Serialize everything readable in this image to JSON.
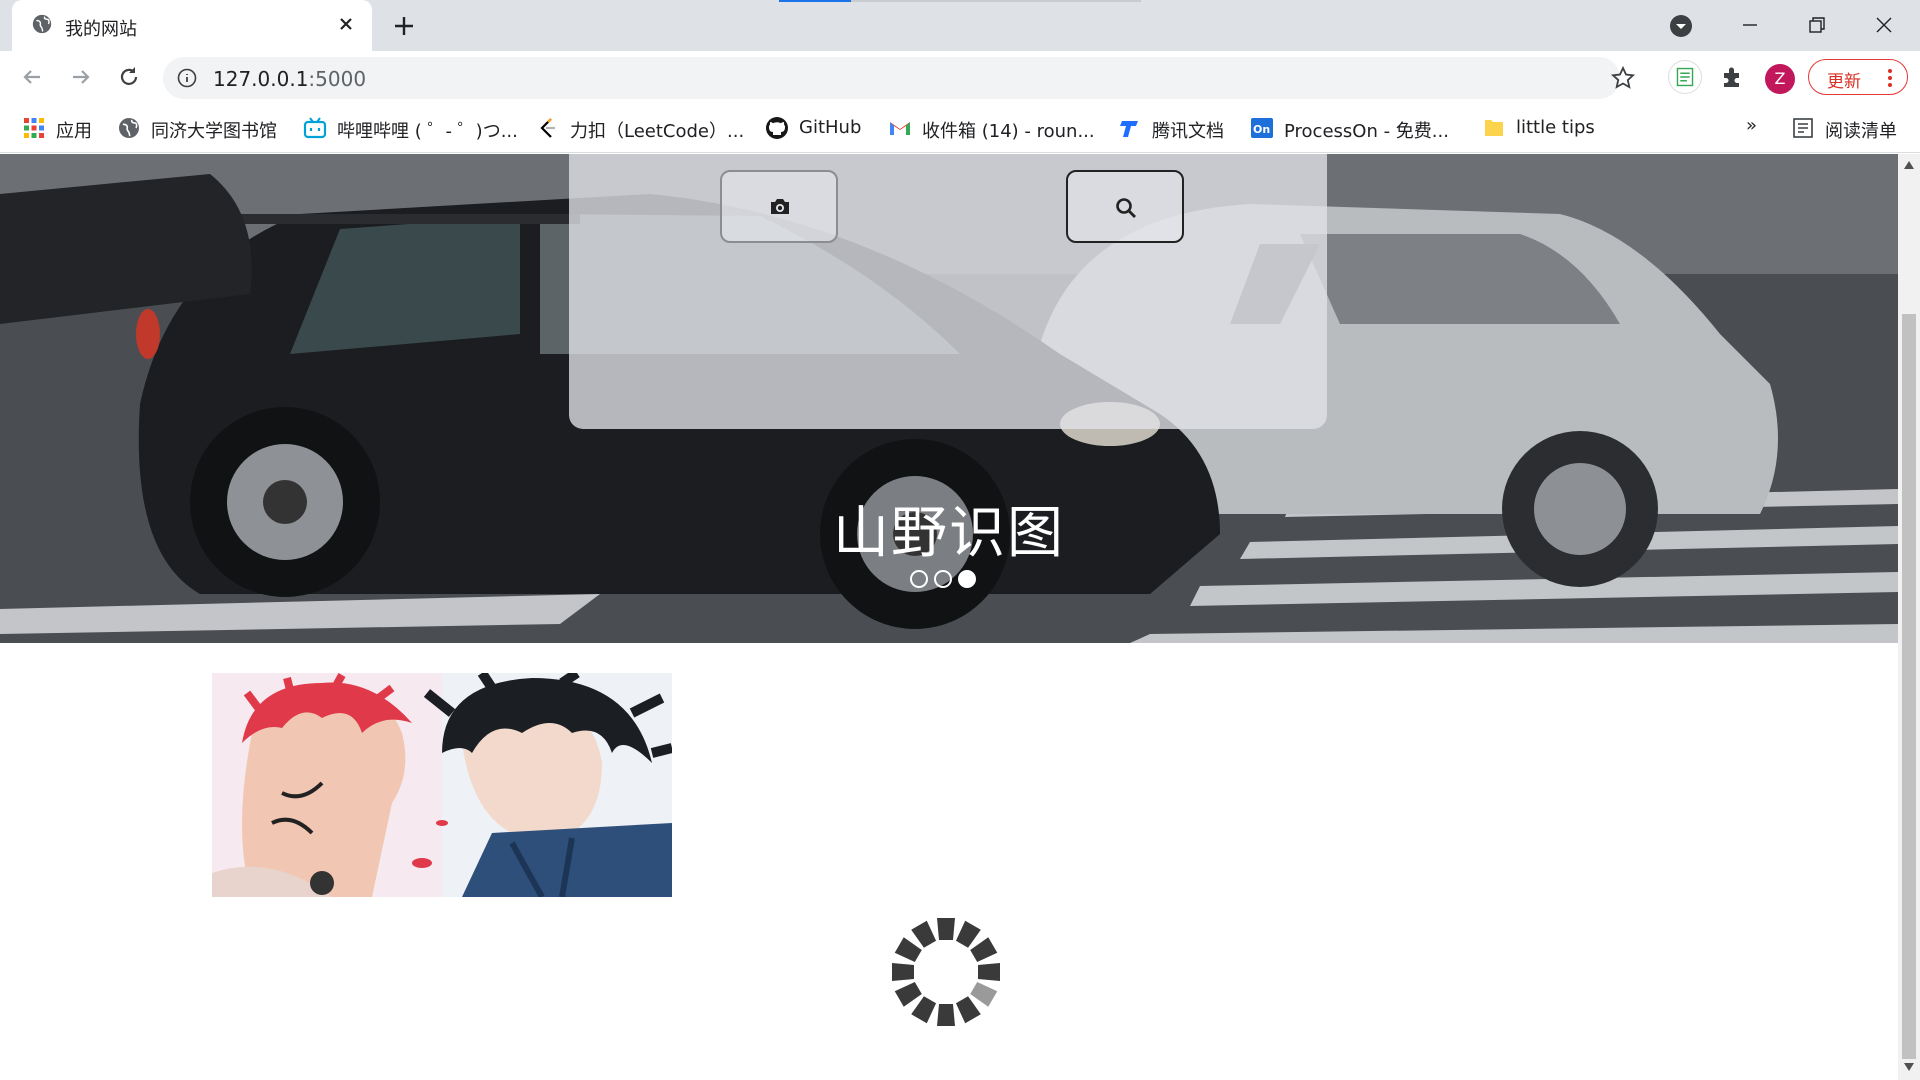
{
  "browser": {
    "tab": {
      "title": "我的网站"
    },
    "url": {
      "host": "127.0.0.1",
      "port": ":5000"
    },
    "update_label": "更新",
    "avatar_initial": "Z",
    "bookmarks": [
      {
        "label": "应用",
        "icon": "apps-grid-icon"
      },
      {
        "label": "同济大学图书馆",
        "icon": "globe-icon"
      },
      {
        "label": "哔哩哔哩 ( ゜- ゜)つ...",
        "icon": "bilibili-icon"
      },
      {
        "label": "力扣（LeetCode）...",
        "icon": "leetcode-icon"
      },
      {
        "label": "GitHub",
        "icon": "github-icon"
      },
      {
        "label": "收件箱 (14) - roun...",
        "icon": "gmail-icon"
      },
      {
        "label": "腾讯文档",
        "icon": "tencent-docs-icon"
      },
      {
        "label": "ProcessOn - 免费...",
        "icon": "processon-icon"
      },
      {
        "label": "little tips",
        "icon": "folder-icon"
      }
    ],
    "more_bookmarks": "»",
    "reading_list": "阅读清单"
  },
  "page": {
    "hero_title": "山野识图",
    "carousel": {
      "count": 3,
      "active_index": 2
    },
    "buttons": {
      "camera": "camera-icon",
      "search": "search-icon"
    }
  },
  "colors": {
    "accent_load": "#1a73e8",
    "update_red": "#d93025",
    "avatar": "#c2185b"
  }
}
